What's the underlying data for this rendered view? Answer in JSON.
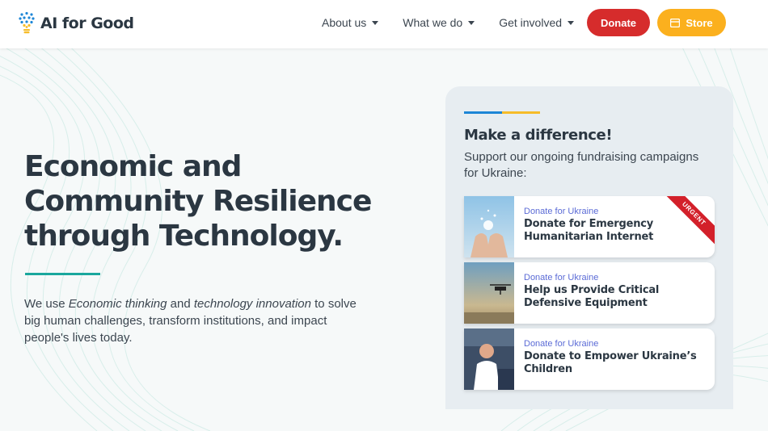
{
  "header": {
    "logo_text": "AI for Good",
    "nav": [
      {
        "label": "About us"
      },
      {
        "label": "What we do"
      },
      {
        "label": "Get involved"
      }
    ],
    "donate_label": "Donate",
    "store_label": "Store"
  },
  "hero": {
    "title_line1": "Economic and",
    "title_line2": "Community Resilience",
    "title_line3": "through Technology.",
    "desc_1": "We use ",
    "desc_em1": "Economic thinking",
    "desc_2": " and ",
    "desc_em2": "technology innovation",
    "desc_3": " to solve big human challenges, transform institutions, and impact people's lives today."
  },
  "panel": {
    "title": "Make a difference!",
    "subtitle": "Support our ongoing fundraising campaigns for Ukraine:",
    "campaigns": [
      {
        "kicker": "Donate for Ukraine",
        "title": "Donate for Emergency Humanitarian Internet",
        "badge": "URGENT"
      },
      {
        "kicker": "Donate for Ukraine",
        "title": "Help us Provide Critical Defensive Equipment"
      },
      {
        "kicker": "Donate for Ukraine",
        "title": "Donate to Empower Ukraine’s Children"
      }
    ]
  },
  "colors": {
    "donate": "#d62c2c",
    "store": "#fbb01e",
    "accent_teal": "#1aa79d",
    "ukraine_blue": "#1d86d6",
    "ukraine_yellow": "#f6bc29",
    "kicker": "#5b6bd6"
  }
}
